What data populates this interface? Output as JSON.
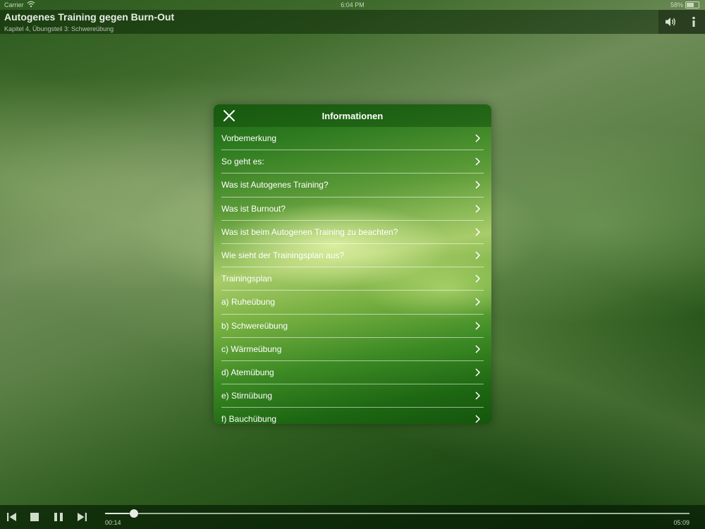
{
  "status_bar": {
    "carrier": "Carrier",
    "time": "6:04 PM",
    "battery": "58%"
  },
  "header": {
    "title": "Autogenes Training gegen Burn-Out",
    "subtitle": "Kapitel 4, Übungsteil 3: Schwereübung",
    "icons": [
      "speaker-icon",
      "info-icon"
    ]
  },
  "modal": {
    "title": "Informationen",
    "close_icon": "close-icon",
    "items": [
      {
        "label": "Vorbemerkung"
      },
      {
        "label": "So geht es:"
      },
      {
        "label": "Was ist Autogenes Training?"
      },
      {
        "label": "Was ist Burnout?"
      },
      {
        "label": "Was ist beim Autogenen Training zu beachten?"
      },
      {
        "label": "Wie sieht der Trainingsplan aus?"
      },
      {
        "label": "Trainingsplan"
      },
      {
        "label": "a) Ruheübung"
      },
      {
        "label": "b) Schwereübung"
      },
      {
        "label": "c) Wärmeübung"
      },
      {
        "label": "d) Atemübung"
      },
      {
        "label": "e) Stirnübung"
      },
      {
        "label": "f) Bauchübung"
      }
    ]
  },
  "player": {
    "elapsed": "00:14",
    "total": "05:09",
    "progress": 0.05,
    "controls": [
      "skip-back-icon",
      "stop-icon",
      "pause-icon",
      "skip-forward-icon"
    ]
  },
  "colors": {
    "accent": "#2d7a1f",
    "dark": "#143d0d"
  }
}
